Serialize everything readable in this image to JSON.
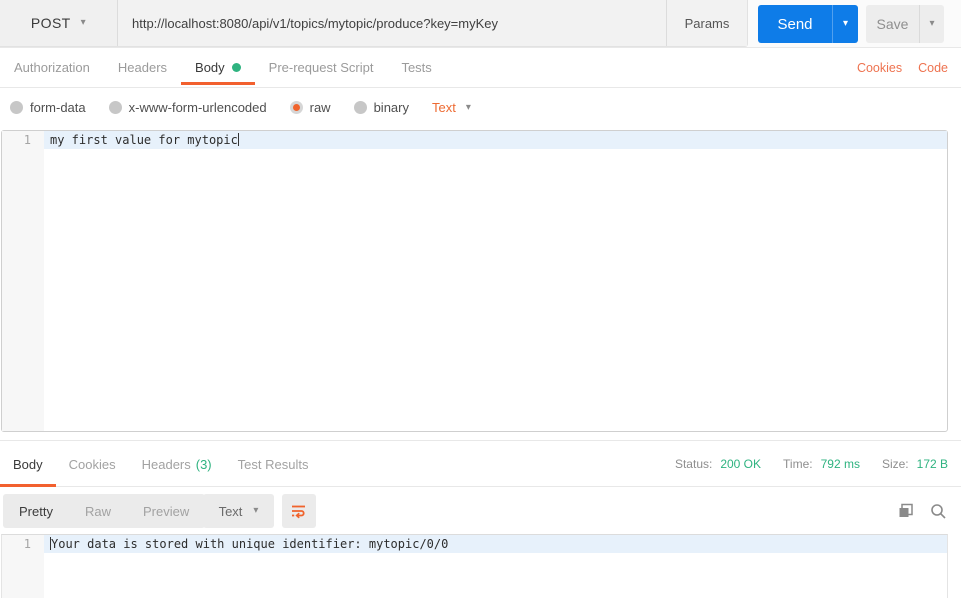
{
  "glyphs": {
    "caret": "▾"
  },
  "colors": {
    "accent_orange": "#f2602e",
    "link_orange": "#ee7350",
    "status_green": "#2fb380",
    "send_blue": "#0e7ce8",
    "active_line_highlight": "#e7f1fb"
  },
  "request_bar": {
    "method": "POST",
    "url": "http://localhost:8080/api/v1/topics/mytopic/produce?key=myKey",
    "params_label": "Params",
    "send_label": "Send",
    "save_label": "Save"
  },
  "request_tabs": {
    "items": [
      {
        "label": "Authorization",
        "active": false
      },
      {
        "label": "Headers",
        "active": false
      },
      {
        "label": "Body",
        "active": true,
        "has_green_dot": true
      },
      {
        "label": "Pre-request Script",
        "active": false
      },
      {
        "label": "Tests",
        "active": false
      }
    ],
    "cookies_link": "Cookies",
    "code_link": "Code"
  },
  "body_type_bar": {
    "options": [
      {
        "label": "form-data",
        "selected": false
      },
      {
        "label": "x-www-form-urlencoded",
        "selected": false
      },
      {
        "label": "raw",
        "selected": true
      },
      {
        "label": "binary",
        "selected": false
      }
    ],
    "format_selector": "Text"
  },
  "request_editor": {
    "line_number": "1",
    "line_content": "my first value for mytopic"
  },
  "response_meta": {
    "tabs": [
      {
        "label": "Body",
        "active": true
      },
      {
        "label": "Cookies",
        "active": false
      },
      {
        "label": "Headers",
        "count": "(3)",
        "active": false
      },
      {
        "label": "Test Results",
        "active": false
      }
    ],
    "status_label": "Status:",
    "status_value": "200 OK",
    "time_label": "Time:",
    "time_value": "792 ms",
    "size_label": "Size:",
    "size_value": "172 B"
  },
  "response_toolbar": {
    "views": [
      {
        "label": "Pretty",
        "active": true
      },
      {
        "label": "Raw",
        "active": false
      },
      {
        "label": "Preview",
        "active": false
      }
    ],
    "format_selector": "Text"
  },
  "response_editor": {
    "line_number": "1",
    "line_content": "Your data is stored with unique identifier: mytopic/0/0"
  }
}
